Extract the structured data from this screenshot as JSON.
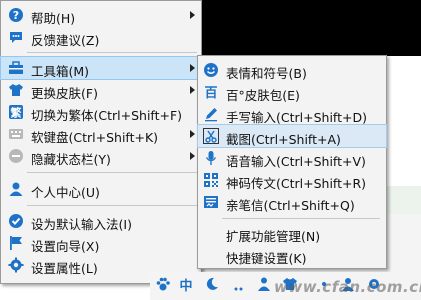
{
  "main_menu": {
    "items": [
      {
        "label": "帮助(H)",
        "icon": "question-icon",
        "submenu": true
      },
      {
        "label": "反馈建议(Z)",
        "icon": "feedback-bubble-icon",
        "submenu": false
      },
      {
        "label": "工具箱(M)",
        "icon": "toolbox-icon",
        "submenu": true
      },
      {
        "label": "更换皮肤(F)",
        "icon": "tshirt-skin-icon",
        "submenu": true
      },
      {
        "label": "切换为繁体(Ctrl+Shift+F)",
        "icon": "traditional-char-icon",
        "submenu": false
      },
      {
        "label": "软键盘(Ctrl+Shift+K)",
        "icon": "keyboard-icon",
        "submenu": true
      },
      {
        "label": "隐藏状态栏(Y)",
        "icon": "minus-circle-icon",
        "submenu": true
      },
      {
        "label": "个人中心(U)",
        "icon": "user-icon",
        "submenu": false
      },
      {
        "label": "设为默认输入法(I)",
        "icon": "check-circle-icon",
        "submenu": false
      },
      {
        "label": "设置向导(X)",
        "icon": "flag-icon",
        "submenu": false
      },
      {
        "label": "设置属性(L)",
        "icon": "gear-icon",
        "submenu": false
      }
    ]
  },
  "toolbox_submenu": {
    "items": [
      {
        "label": "表情和符号(B)",
        "icon": "smiley-icon"
      },
      {
        "label": "百°皮肤包(E)",
        "icon": "skin-pack-icon"
      },
      {
        "label": "手写输入(Ctrl+Shift+D)",
        "icon": "pen-icon"
      },
      {
        "label": "截图(Ctrl+Shift+A)",
        "icon": "scissors-icon"
      },
      {
        "label": "语音输入(Ctrl+Shift+V)",
        "icon": "microphone-icon"
      },
      {
        "label": "神码传文(Ctrl+Shift+R)",
        "icon": "qr-code-icon"
      },
      {
        "label": "亲笔信(Ctrl+Shift+Q)",
        "icon": "letter-icon"
      },
      {
        "label": "扩展功能管理(N)",
        "icon": ""
      },
      {
        "label": "快捷键设置(K)",
        "icon": ""
      }
    ]
  },
  "statusbar": {
    "icons": [
      "paw-icon",
      "chinese-mode-icon",
      "moon-icon",
      "punctuation-icon",
      "person-icon",
      "shirt-icon",
      "dots-icon",
      "user-icon",
      "settings-icon"
    ],
    "chinese_mode_label": "中"
  },
  "watermark": "www.cfan.com.cn",
  "colors": {
    "accent": "#1e73c8",
    "highlight": "#cce4f7",
    "menu_bg": "#f3f3f3"
  }
}
